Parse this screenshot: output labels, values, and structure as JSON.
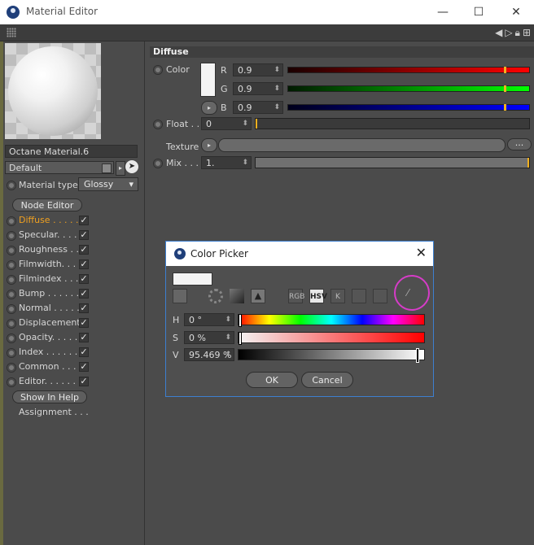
{
  "window": {
    "title": "Material Editor",
    "minimize": "—",
    "maximize": "☐",
    "close": "✕"
  },
  "left": {
    "material_name": "Octane Material.6",
    "layer": "Default",
    "material_type_label": "Material type",
    "material_type_value": "Glossy",
    "node_editor": "Node Editor",
    "channels": [
      {
        "label": "Diffuse . . . . .",
        "checked": "✓"
      },
      {
        "label": "Specular. . . . .",
        "checked": "✓"
      },
      {
        "label": "Roughness . . .",
        "checked": "✓"
      },
      {
        "label": "Filmwidth. . . .",
        "checked": "✓"
      },
      {
        "label": "Filmindex . . . .",
        "checked": "✓"
      },
      {
        "label": "Bump . . . . . .",
        "checked": "✓"
      },
      {
        "label": "Normal . . . . .",
        "checked": "✓"
      },
      {
        "label": "Displacement",
        "checked": "✓"
      },
      {
        "label": "Opacity. . . . . .",
        "checked": "✓"
      },
      {
        "label": "Index . . . . . .",
        "checked": "✓"
      },
      {
        "label": "Common . . . .",
        "checked": "✓"
      },
      {
        "label": "Editor. . . . . .",
        "checked": "✓"
      }
    ],
    "show_in_help": "Show In Help",
    "assignment": "Assignment . . ."
  },
  "diffuse": {
    "section": "Diffuse",
    "color_label": "Color",
    "r_label": "R",
    "r_value": "0.9",
    "g_label": "G",
    "g_value": "0.9",
    "b_label": "B",
    "b_value": "0.9",
    "float_label": "Float . .",
    "float_value": "0",
    "texture_label": "Texture",
    "texture_more": "...",
    "mix_label": "Mix . . .",
    "mix_value": "1."
  },
  "picker": {
    "title": "Color Picker",
    "modes": [
      "RGB",
      "HSV",
      "K",
      "",
      ""
    ],
    "h_label": "H",
    "h_value": "0 °",
    "s_label": "S",
    "s_value": "0 %",
    "v_label": "V",
    "v_value": "95.469 %",
    "ok": "OK",
    "cancel": "Cancel",
    "close": "✕"
  }
}
